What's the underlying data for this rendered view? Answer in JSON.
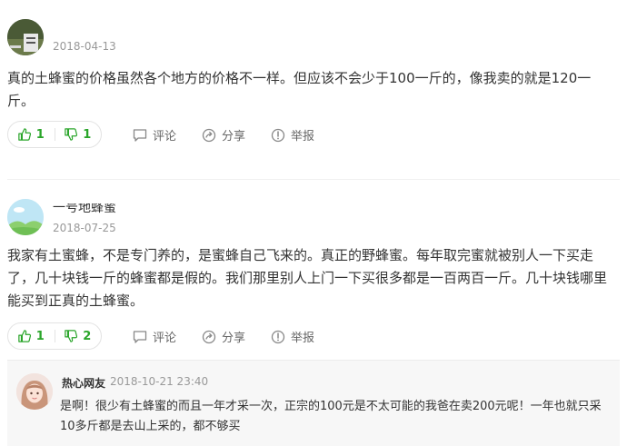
{
  "comments": [
    {
      "username": "",
      "date": "2018-04-13",
      "text": "真的土蜂蜜的价格虽然各个地方的价格不一样。但应该不会少于100一斤的，像我卖的就是120一斤。",
      "likes": "1",
      "dislikes": "1",
      "actions": {
        "comment": "评论",
        "share": "分享",
        "report": "举报"
      }
    },
    {
      "username": "一号地蜂蜜",
      "date": "2018-07-25",
      "text": "我家有土蜜蜂，不是专门养的，是蜜蜂自己飞来的。真正的野蜂蜜。每年取完蜜就被别人一下买走了，几十块钱一斤的蜂蜜都是假的。我们那里别人上门一下买很多都是一百两百一斤。几十块钱哪里能买到正真的土蜂蜜。",
      "likes": "1",
      "dislikes": "2",
      "actions": {
        "comment": "评论",
        "share": "分享",
        "report": "举报"
      }
    }
  ],
  "reply": {
    "username": "热心网友",
    "datetime": "2018-10-21 23:40",
    "text": "是啊！很少有土蜂蜜的而且一年才采一次，正宗的100元是不太可能的我爸在卖200元呢！一年也就只采10多斤都是去山上采的，都不够买"
  },
  "colors": {
    "accent_green": "#2aa52a",
    "muted": "#999999",
    "reply_bg": "#f7f7f7"
  },
  "icons": [
    "thumbs-up-icon",
    "thumbs-down-icon",
    "comment-icon",
    "share-icon",
    "report-icon"
  ]
}
